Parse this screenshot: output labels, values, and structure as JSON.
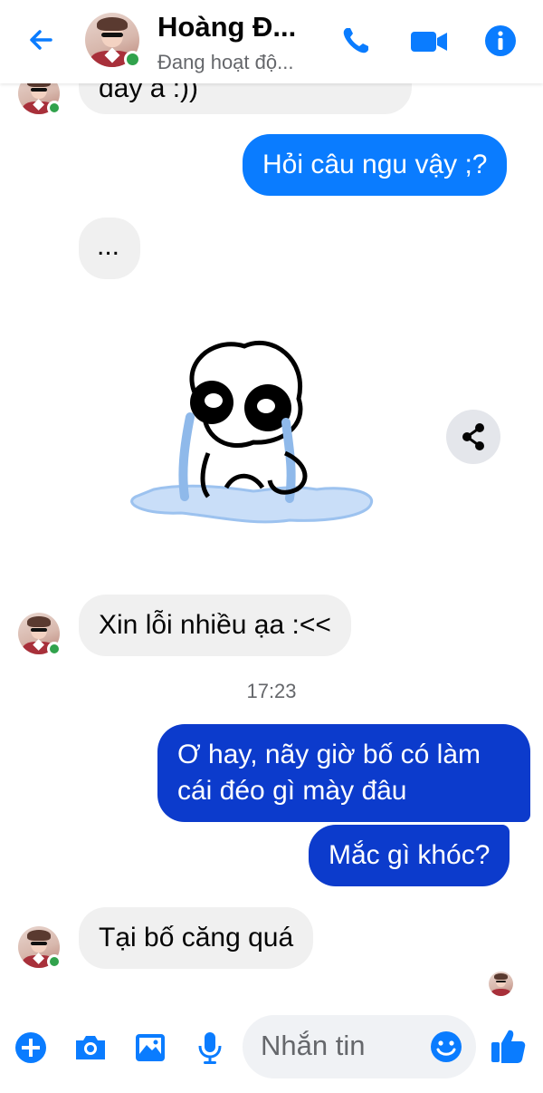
{
  "header": {
    "contact_name": "Hoàng Đ...",
    "status": "Đang hoạt độ...",
    "back_icon": "back-arrow-icon",
    "call_icon": "phone-icon",
    "video_icon": "video-camera-icon",
    "info_icon": "info-icon",
    "accent_color": "#0a7cff"
  },
  "messages": [
    {
      "from": "them",
      "text": "đấy à :))"
    },
    {
      "from": "me",
      "text": "Hỏi câu ngu vậy ;?"
    },
    {
      "from": "them",
      "text": "..."
    },
    {
      "from": "them",
      "type": "sticker",
      "description_icon": "crying-sticker"
    },
    {
      "from": "them",
      "text": "Xin lỗi nhiều ạa :<<"
    },
    {
      "type": "timestamp",
      "text": "17:23"
    },
    {
      "from": "me",
      "text_line1": "Ơ hay, nãy giờ bố có làm",
      "text_line2": "cái đéo gì mày đâu"
    },
    {
      "from": "me",
      "text": "Mắc gì khóc?"
    },
    {
      "from": "them",
      "text": "Tại bố căng quá"
    }
  ],
  "composer": {
    "placeholder": "Nhắn tin",
    "icons": [
      "plus-icon",
      "camera-icon",
      "gallery-icon",
      "microphone-icon",
      "emoji-icon",
      "thumbs-up-icon"
    ]
  }
}
